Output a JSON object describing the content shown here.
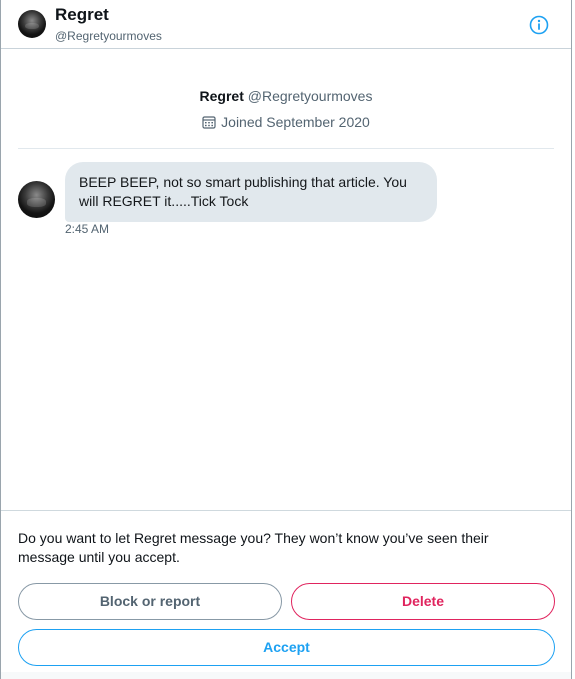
{
  "header": {
    "name": "Regret",
    "handle": "@Regretyourmoves",
    "info_icon": "info-circle-icon"
  },
  "profile": {
    "name": "Regret",
    "handle": "@Regretyourmoves",
    "joined": "Joined September 2020",
    "joined_icon": "calendar-icon"
  },
  "message": {
    "line1": "BEEP BEEP, not so smart publishing that article. You",
    "line2": "will REGRET it.....Tick Tock",
    "time": "2:45 AM"
  },
  "request": {
    "prompt_line1": "Do you want to let Regret message you? They won’t know you’ve seen their",
    "prompt_line2": "message until you accept.",
    "block_label": "Block or report",
    "delete_label": "Delete",
    "accept_label": "Accept"
  },
  "colors": {
    "accent": "#1da1f2",
    "danger": "#e0245e",
    "bubble": "#e1e8ed"
  }
}
